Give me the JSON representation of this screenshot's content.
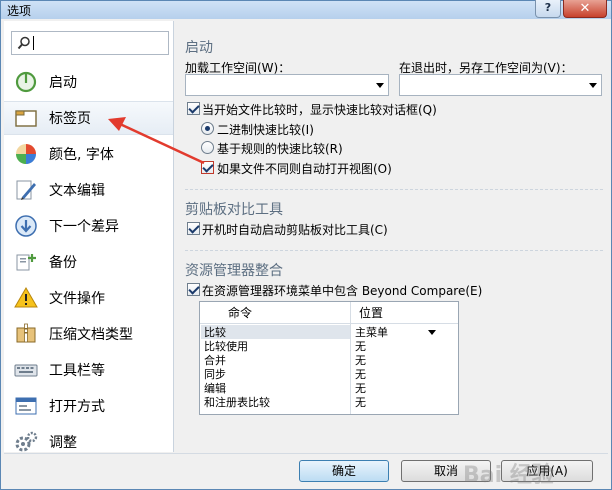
{
  "window": {
    "title": "选项",
    "help_label": "?",
    "close_label": "✕"
  },
  "search": {
    "value": "",
    "placeholder": ""
  },
  "sidebar": {
    "items": [
      {
        "label": "启动",
        "icon": "power-icon",
        "active": false
      },
      {
        "label": "标签页",
        "icon": "tab-page-icon",
        "active": true
      },
      {
        "label": "颜色, 字体",
        "icon": "palette-icon",
        "active": false
      },
      {
        "label": "文本编辑",
        "icon": "pencil-icon",
        "active": false
      },
      {
        "label": "下一个差异",
        "icon": "down-arrow-icon",
        "active": false
      },
      {
        "label": "备份",
        "icon": "backup-icon",
        "active": false
      },
      {
        "label": "文件操作",
        "icon": "warning-icon",
        "active": false
      },
      {
        "label": "压缩文档类型",
        "icon": "archive-icon",
        "active": false
      },
      {
        "label": "工具栏等",
        "icon": "keyboard-icon",
        "active": false
      },
      {
        "label": "打开方式",
        "icon": "open-with-icon",
        "active": false
      },
      {
        "label": "调整",
        "icon": "gears-icon",
        "active": false
      }
    ]
  },
  "startup": {
    "title": "启动",
    "load_workspace_label": "加载工作空间(W)：",
    "load_workspace_value": "",
    "save_workspace_label": "在退出时，另存工作空间为(V)：",
    "save_workspace_value": "",
    "show_quick_compare": {
      "label": "当开始文件比较时，显示快速比较对话框(Q)",
      "checked": true
    },
    "binary_quick": {
      "label": "二进制快速比较(I)",
      "selected": true
    },
    "rules_quick": {
      "label": "基于规则的快速比较(R)",
      "selected": false
    },
    "auto_open_view": {
      "label": "如果文件不同则自动打开视图(O)",
      "checked": true
    }
  },
  "clipboard": {
    "title": "剪贴板对比工具",
    "auto_start": {
      "label": "开机时自动启动剪贴板对比工具(C)",
      "checked": true
    }
  },
  "explorer": {
    "title": "资源管理器整合",
    "include_menu": {
      "label": "在资源管理器环境菜单中包含 Beyond Compare(E)",
      "checked": true
    },
    "columns": [
      "命令",
      "位置"
    ],
    "rows": [
      {
        "command": "比较",
        "location": "主菜单"
      },
      {
        "command": "比较使用",
        "location": "无"
      },
      {
        "command": "合并",
        "location": "无"
      },
      {
        "command": "同步",
        "location": "无"
      },
      {
        "command": "编辑",
        "location": "无"
      },
      {
        "command": "和注册表比较",
        "location": "无"
      }
    ]
  },
  "footer": {
    "ok": "确定",
    "cancel": "取消",
    "apply": "应用(A)"
  },
  "watermark": "Bai 经验",
  "colors": {
    "accent": "#3c7fb1",
    "callout": "#e23b2e",
    "close": "#c7412d"
  }
}
